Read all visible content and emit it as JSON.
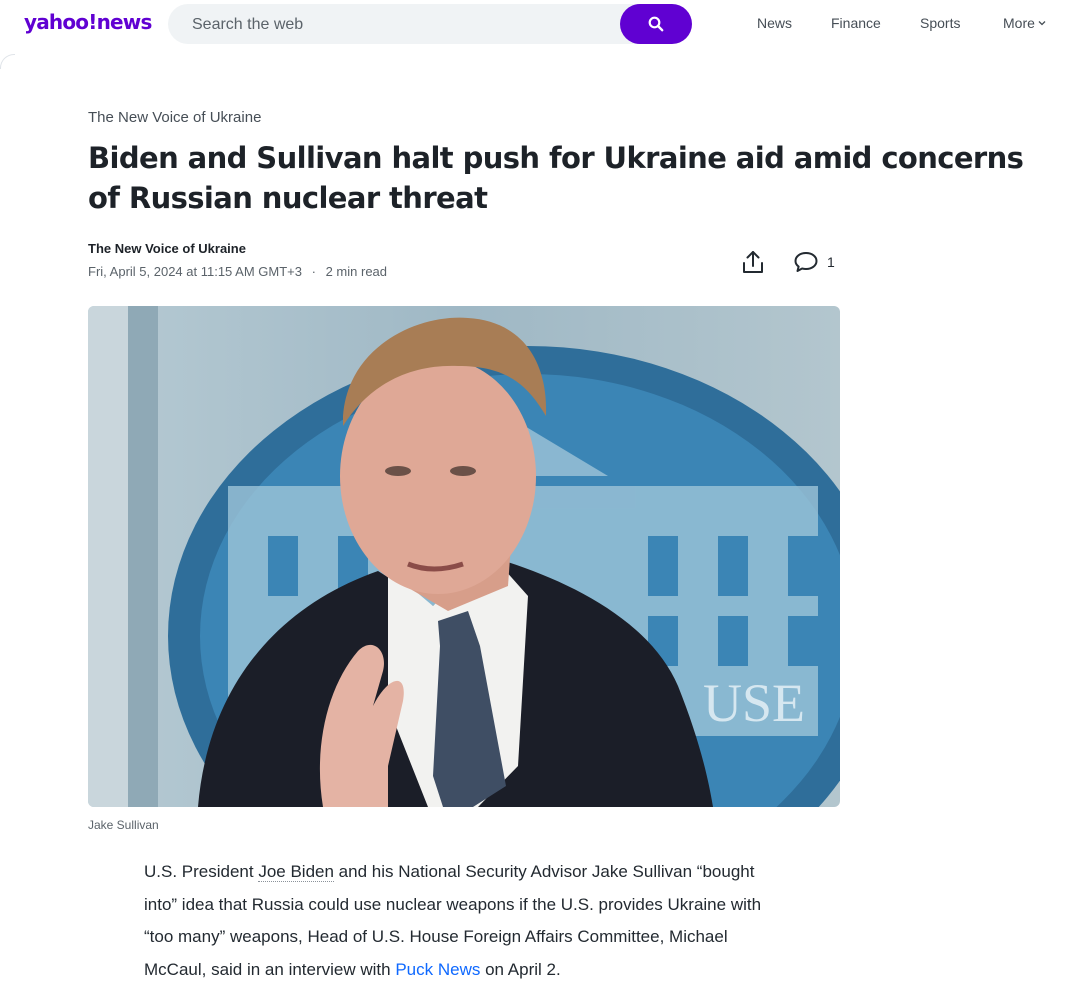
{
  "header": {
    "logo_text": "yahoo!news",
    "search_placeholder": "Search the web",
    "nav": [
      "News",
      "Finance",
      "Sports",
      "More"
    ],
    "brand_color": "#6001d2"
  },
  "article": {
    "provider": "The New Voice of Ukraine",
    "headline": "Biden and Sullivan halt push for Ukraine aid amid concerns of Russian nuclear threat",
    "author": "The New Voice of Ukraine",
    "date": "Fri, April 5, 2024 at 11:15 AM GMT+3",
    "read_time": "2 min read",
    "comment_count": "1",
    "image_caption": "Jake Sullivan",
    "image_text": "USE",
    "body": {
      "part1": "U.S. President ",
      "entity": "Joe Biden",
      "part2": " and his National Security Advisor Jake Sullivan “bought into” idea that Russia could use nuclear weapons if the U.S. provides Ukraine with “too many” weapons, Head of U.S. House Foreign Affairs Committee, Michael McCaul, said in an interview with ",
      "link": "Puck News",
      "part3": " on April 2."
    }
  }
}
